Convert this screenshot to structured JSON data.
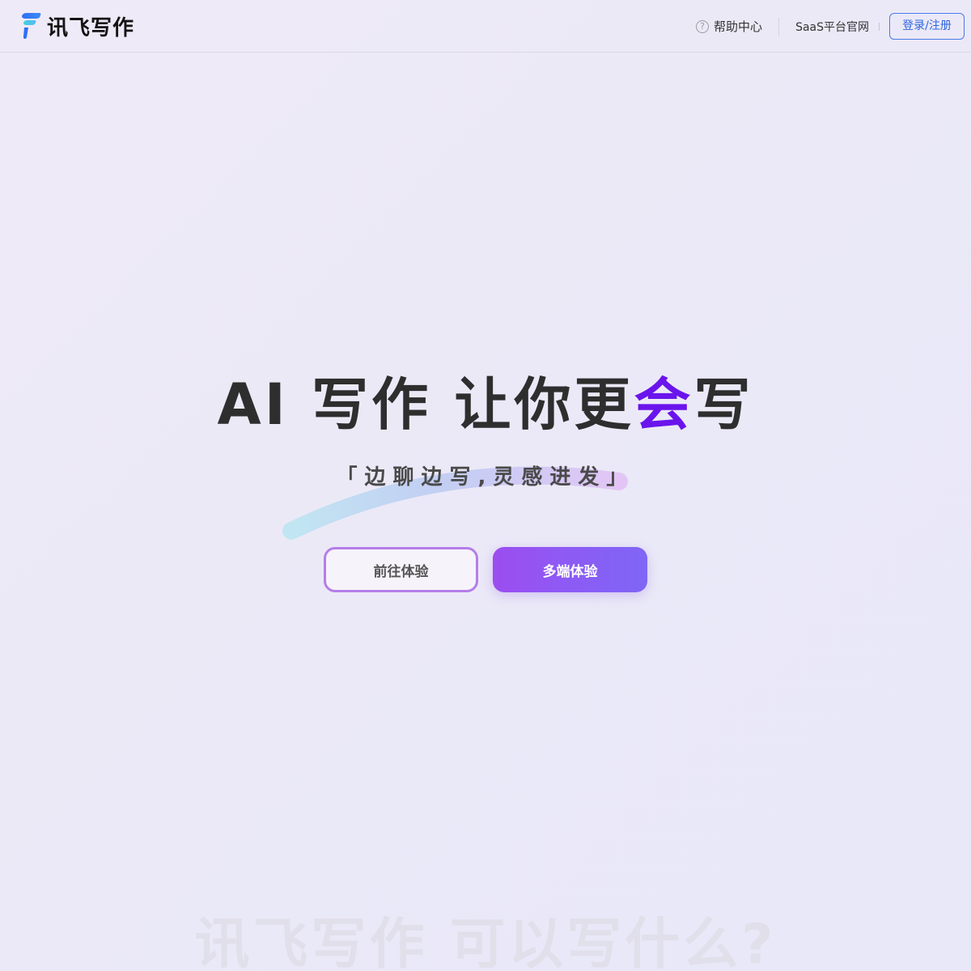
{
  "brand": {
    "name": "讯飞写作"
  },
  "nav": {
    "help_label": "帮助中心",
    "help_icon": "?",
    "saas_label": "SaaS平台官网",
    "login_label": "登录/注册"
  },
  "hero": {
    "title_part1": "AI 写作 让你更",
    "title_highlight": "会",
    "title_part2": "写",
    "subtitle": "「边聊边写,灵感进发」",
    "primary_button": "前往体验",
    "secondary_button": "多端体验"
  },
  "section": {
    "title": "讯飞写作 可以写什么?"
  },
  "colors": {
    "highlight": "#6a14ec",
    "login_border": "#4a7be6",
    "button_gradient_start": "#9c4df0",
    "button_gradient_end": "#7f66f6"
  },
  "icons": {
    "logo": "xunfei-logo-icon",
    "help": "question-circle-icon"
  }
}
